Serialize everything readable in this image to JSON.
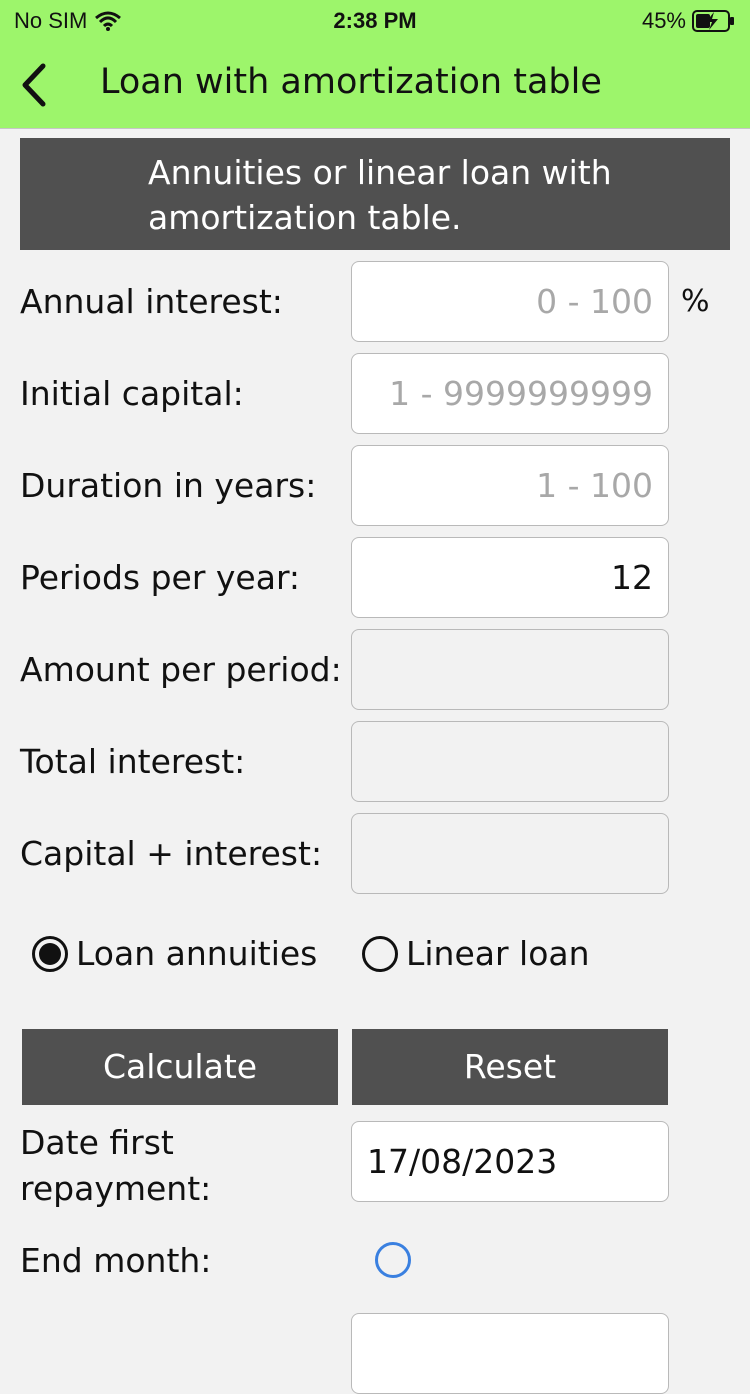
{
  "status": {
    "carrier": "No SIM",
    "time": "2:38 PM",
    "battery": "45%"
  },
  "nav": {
    "title": "Loan with amortization table",
    "back_icon": "chevron-left-icon"
  },
  "header": {
    "text": "Annuities or linear loan with amortization table."
  },
  "form": {
    "annual_interest": {
      "label": "Annual interest:",
      "placeholder": "0 - 100",
      "unit": "%"
    },
    "initial_capital": {
      "label": "Initial capital:",
      "placeholder": "1 - 9999999999"
    },
    "duration": {
      "label": "Duration in years:",
      "placeholder": "1 - 100"
    },
    "periods": {
      "label": "Periods per year:",
      "value": "12"
    },
    "amount_per_period": {
      "label": "Amount per period:",
      "value": ""
    },
    "total_interest": {
      "label": "Total interest:",
      "value": ""
    },
    "capital_interest": {
      "label": "Capital + interest:",
      "value": ""
    }
  },
  "loan_type": {
    "options": [
      "Loan annuities",
      "Linear loan"
    ],
    "selected": "Loan annuities"
  },
  "buttons": {
    "calculate": "Calculate",
    "reset": "Reset"
  },
  "date_first": {
    "label": "Date first repayment:",
    "value": "17/08/2023"
  },
  "end_month": {
    "label": "End month:"
  },
  "colors": {
    "navbar": "#9df56b",
    "dark_button": "#505050",
    "radio_blue": "#3a80e0"
  }
}
